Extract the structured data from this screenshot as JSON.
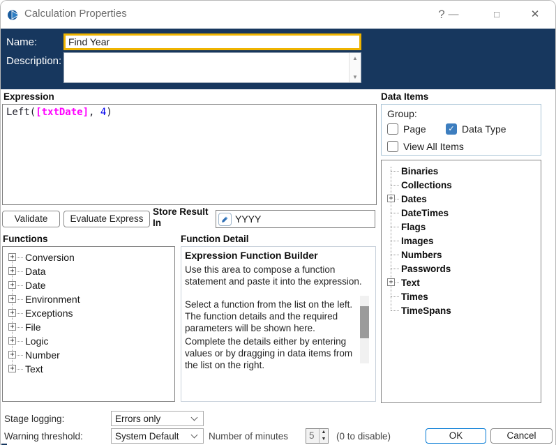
{
  "window": {
    "title": "Calculation Properties",
    "controls": {
      "help": "?",
      "minimize": "—",
      "maximize": "□",
      "close": "✕"
    }
  },
  "colors": {
    "header_navy": "#17375e",
    "name_field_border_gold": "#efb400",
    "checkbox_checked_blue": "#3d7ebf",
    "expression_data_item": "#ff00ff",
    "expression_number": "#0000ee",
    "ok_button_border": "#0078d4"
  },
  "header": {
    "name_label": "Name:",
    "name_value": "Find Year",
    "description_label": "Description:",
    "description_value": ""
  },
  "expression": {
    "label": "Expression",
    "full_text": "Left([txtDate], 4)",
    "parts": [
      {
        "text": "Left(",
        "color": "#1c1c28"
      },
      {
        "text": "[txtDate]",
        "color": "#ff00ff"
      },
      {
        "text": ", ",
        "color": "#1c1c28"
      },
      {
        "text": "4",
        "color": "#0000ee"
      },
      {
        "text": ")",
        "color": "#1c1c28"
      }
    ]
  },
  "actions": {
    "validate": "Validate",
    "evaluate": "Evaluate Express",
    "store_result_label": "Store Result In",
    "store_result_value": "YYYY"
  },
  "functions": {
    "label": "Functions",
    "items": [
      "Conversion",
      "Data",
      "Date",
      "Environment",
      "Exceptions",
      "File",
      "Logic",
      "Number",
      "Text"
    ]
  },
  "function_detail": {
    "label": "Function Detail",
    "heading": "Expression Function Builder",
    "paragraphs": [
      "Use this area to compose a function statement and paste it into the expression.",
      "Select a function from the list on the left. The function details and the required parameters will be shown here.",
      "Complete the details either by entering values or by dragging in data items from the list on the right."
    ]
  },
  "data_items": {
    "label": "Data Items",
    "group_label": "Group:",
    "checkboxes": [
      {
        "label": "Page",
        "checked": false
      },
      {
        "label": "Data Type",
        "checked": true
      },
      {
        "label": "View All Items",
        "checked": false
      }
    ],
    "tree": [
      {
        "label": "Binaries",
        "expandable": false
      },
      {
        "label": "Collections",
        "expandable": false
      },
      {
        "label": "Dates",
        "expandable": true
      },
      {
        "label": "DateTimes",
        "expandable": false
      },
      {
        "label": "Flags",
        "expandable": false
      },
      {
        "label": "Images",
        "expandable": false
      },
      {
        "label": "Numbers",
        "expandable": false
      },
      {
        "label": "Passwords",
        "expandable": false
      },
      {
        "label": "Text",
        "expandable": true
      },
      {
        "label": "Times",
        "expandable": false
      },
      {
        "label": "TimeSpans",
        "expandable": false
      }
    ]
  },
  "footer": {
    "stage_logging_label": "Stage logging:",
    "stage_logging_value": "Errors only",
    "warning_threshold_label": "Warning threshold:",
    "warning_threshold_value": "System Default",
    "minutes_label": "Number of minutes",
    "minutes_value": "5",
    "disable_hint": "(0 to disable)",
    "ok": "OK",
    "cancel": "Cancel"
  }
}
